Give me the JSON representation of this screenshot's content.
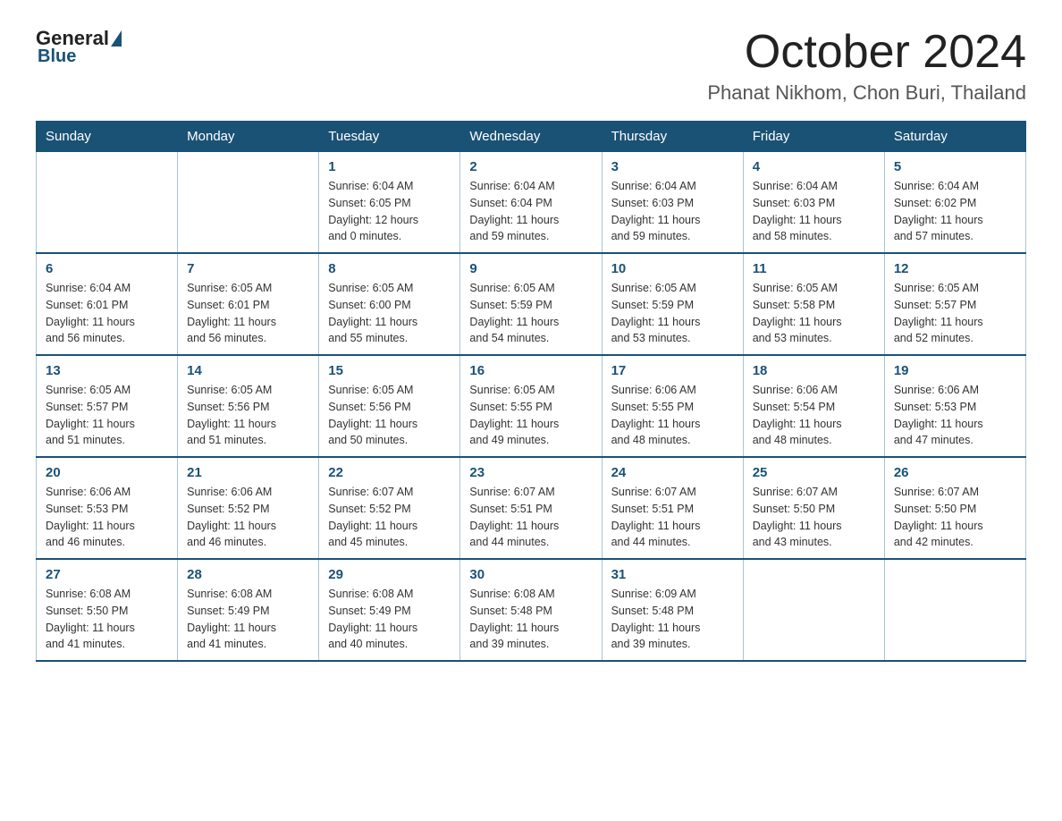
{
  "header": {
    "logo_general": "General",
    "logo_blue": "Blue",
    "title": "October 2024",
    "subtitle": "Phanat Nikhom, Chon Buri, Thailand"
  },
  "calendar": {
    "days_of_week": [
      "Sunday",
      "Monday",
      "Tuesday",
      "Wednesday",
      "Thursday",
      "Friday",
      "Saturday"
    ],
    "weeks": [
      [
        {
          "day": "",
          "info": ""
        },
        {
          "day": "",
          "info": ""
        },
        {
          "day": "1",
          "info": "Sunrise: 6:04 AM\nSunset: 6:05 PM\nDaylight: 12 hours\nand 0 minutes."
        },
        {
          "day": "2",
          "info": "Sunrise: 6:04 AM\nSunset: 6:04 PM\nDaylight: 11 hours\nand 59 minutes."
        },
        {
          "day": "3",
          "info": "Sunrise: 6:04 AM\nSunset: 6:03 PM\nDaylight: 11 hours\nand 59 minutes."
        },
        {
          "day": "4",
          "info": "Sunrise: 6:04 AM\nSunset: 6:03 PM\nDaylight: 11 hours\nand 58 minutes."
        },
        {
          "day": "5",
          "info": "Sunrise: 6:04 AM\nSunset: 6:02 PM\nDaylight: 11 hours\nand 57 minutes."
        }
      ],
      [
        {
          "day": "6",
          "info": "Sunrise: 6:04 AM\nSunset: 6:01 PM\nDaylight: 11 hours\nand 56 minutes."
        },
        {
          "day": "7",
          "info": "Sunrise: 6:05 AM\nSunset: 6:01 PM\nDaylight: 11 hours\nand 56 minutes."
        },
        {
          "day": "8",
          "info": "Sunrise: 6:05 AM\nSunset: 6:00 PM\nDaylight: 11 hours\nand 55 minutes."
        },
        {
          "day": "9",
          "info": "Sunrise: 6:05 AM\nSunset: 5:59 PM\nDaylight: 11 hours\nand 54 minutes."
        },
        {
          "day": "10",
          "info": "Sunrise: 6:05 AM\nSunset: 5:59 PM\nDaylight: 11 hours\nand 53 minutes."
        },
        {
          "day": "11",
          "info": "Sunrise: 6:05 AM\nSunset: 5:58 PM\nDaylight: 11 hours\nand 53 minutes."
        },
        {
          "day": "12",
          "info": "Sunrise: 6:05 AM\nSunset: 5:57 PM\nDaylight: 11 hours\nand 52 minutes."
        }
      ],
      [
        {
          "day": "13",
          "info": "Sunrise: 6:05 AM\nSunset: 5:57 PM\nDaylight: 11 hours\nand 51 minutes."
        },
        {
          "day": "14",
          "info": "Sunrise: 6:05 AM\nSunset: 5:56 PM\nDaylight: 11 hours\nand 51 minutes."
        },
        {
          "day": "15",
          "info": "Sunrise: 6:05 AM\nSunset: 5:56 PM\nDaylight: 11 hours\nand 50 minutes."
        },
        {
          "day": "16",
          "info": "Sunrise: 6:05 AM\nSunset: 5:55 PM\nDaylight: 11 hours\nand 49 minutes."
        },
        {
          "day": "17",
          "info": "Sunrise: 6:06 AM\nSunset: 5:55 PM\nDaylight: 11 hours\nand 48 minutes."
        },
        {
          "day": "18",
          "info": "Sunrise: 6:06 AM\nSunset: 5:54 PM\nDaylight: 11 hours\nand 48 minutes."
        },
        {
          "day": "19",
          "info": "Sunrise: 6:06 AM\nSunset: 5:53 PM\nDaylight: 11 hours\nand 47 minutes."
        }
      ],
      [
        {
          "day": "20",
          "info": "Sunrise: 6:06 AM\nSunset: 5:53 PM\nDaylight: 11 hours\nand 46 minutes."
        },
        {
          "day": "21",
          "info": "Sunrise: 6:06 AM\nSunset: 5:52 PM\nDaylight: 11 hours\nand 46 minutes."
        },
        {
          "day": "22",
          "info": "Sunrise: 6:07 AM\nSunset: 5:52 PM\nDaylight: 11 hours\nand 45 minutes."
        },
        {
          "day": "23",
          "info": "Sunrise: 6:07 AM\nSunset: 5:51 PM\nDaylight: 11 hours\nand 44 minutes."
        },
        {
          "day": "24",
          "info": "Sunrise: 6:07 AM\nSunset: 5:51 PM\nDaylight: 11 hours\nand 44 minutes."
        },
        {
          "day": "25",
          "info": "Sunrise: 6:07 AM\nSunset: 5:50 PM\nDaylight: 11 hours\nand 43 minutes."
        },
        {
          "day": "26",
          "info": "Sunrise: 6:07 AM\nSunset: 5:50 PM\nDaylight: 11 hours\nand 42 minutes."
        }
      ],
      [
        {
          "day": "27",
          "info": "Sunrise: 6:08 AM\nSunset: 5:50 PM\nDaylight: 11 hours\nand 41 minutes."
        },
        {
          "day": "28",
          "info": "Sunrise: 6:08 AM\nSunset: 5:49 PM\nDaylight: 11 hours\nand 41 minutes."
        },
        {
          "day": "29",
          "info": "Sunrise: 6:08 AM\nSunset: 5:49 PM\nDaylight: 11 hours\nand 40 minutes."
        },
        {
          "day": "30",
          "info": "Sunrise: 6:08 AM\nSunset: 5:48 PM\nDaylight: 11 hours\nand 39 minutes."
        },
        {
          "day": "31",
          "info": "Sunrise: 6:09 AM\nSunset: 5:48 PM\nDaylight: 11 hours\nand 39 minutes."
        },
        {
          "day": "",
          "info": ""
        },
        {
          "day": "",
          "info": ""
        }
      ]
    ]
  }
}
